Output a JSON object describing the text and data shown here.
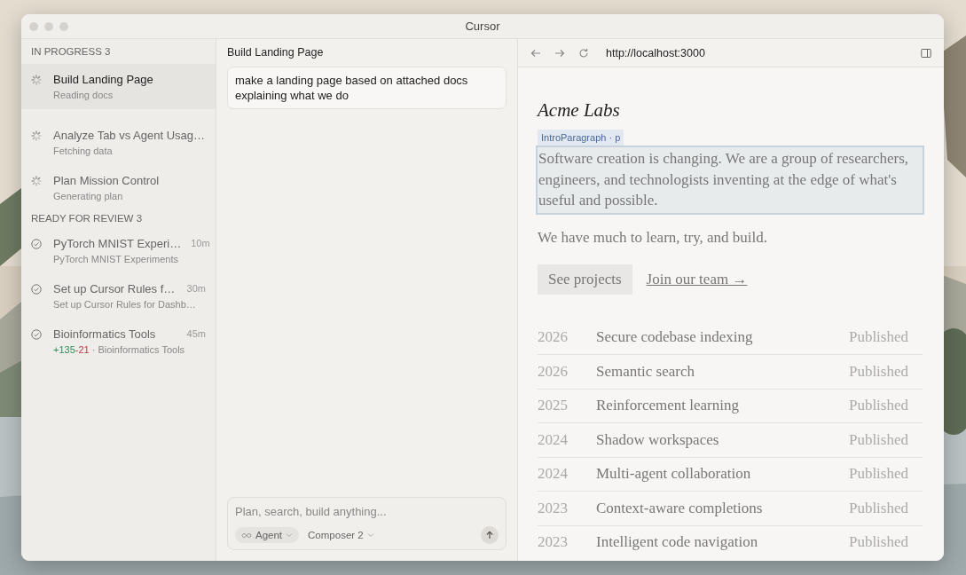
{
  "window": {
    "title": "Cursor"
  },
  "sidebar": {
    "sections": [
      {
        "title": "IN PROGRESS 3",
        "items": [
          {
            "kind": "running",
            "title": "Build Landing Page",
            "subtitle": "Reading docs",
            "selected": true
          },
          {
            "kind": "running",
            "title": "Analyze Tab vs Agent Usag…",
            "subtitle": "Fetching data",
            "selected": false
          },
          {
            "kind": "running",
            "title": "Plan Mission Control",
            "subtitle": "Generating plan",
            "selected": false
          }
        ]
      },
      {
        "title": "READY FOR REVIEW 3",
        "items": [
          {
            "kind": "done",
            "title": "PyTorch MNIST Experi…",
            "time": "10m",
            "subtitle": "PyTorch MNIST Experiments",
            "selected": false
          },
          {
            "kind": "done",
            "title": "Set up Cursor Rules f…",
            "time": "30m",
            "subtitle": "Set up Cursor Rules for Dashb…",
            "selected": false
          },
          {
            "kind": "done",
            "title": "Bioinformatics Tools",
            "time": "45m",
            "additions": "+135",
            "deletions": "-21",
            "subtitle": "· Bioinformatics Tools",
            "selected": false
          }
        ]
      }
    ]
  },
  "chat": {
    "title": "Build Landing Page",
    "messages": [
      "make a landing page based on attached docs explaining what we do"
    ],
    "composer": {
      "placeholder": "Plan, search, build anything...",
      "mode": "Agent",
      "model": "Composer 2"
    }
  },
  "browser": {
    "url": "http://localhost:3000",
    "page": {
      "logo": "Acme Labs",
      "inspector_label": "IntroParagraph · p",
      "intro": "Software creation is changing. We are a group of researchers, engineers, and technologists inventing at the edge of what's useful and possible.",
      "tagline": "We have much to learn, try, and build.",
      "primary_button": "See projects",
      "link": "Join our team →",
      "projects": [
        {
          "year": "2026",
          "title": "Secure codebase indexing",
          "status": "Published"
        },
        {
          "year": "2026",
          "title": "Semantic search",
          "status": "Published"
        },
        {
          "year": "2025",
          "title": "Reinforcement learning",
          "status": "Published"
        },
        {
          "year": "2024",
          "title": "Shadow workspaces",
          "status": "Published"
        },
        {
          "year": "2024",
          "title": "Multi-agent collaboration",
          "status": "Published"
        },
        {
          "year": "2023",
          "title": "Context-aware completions",
          "status": "Published"
        },
        {
          "year": "2023",
          "title": "Intelligent code navigation",
          "status": "Published"
        }
      ]
    }
  }
}
